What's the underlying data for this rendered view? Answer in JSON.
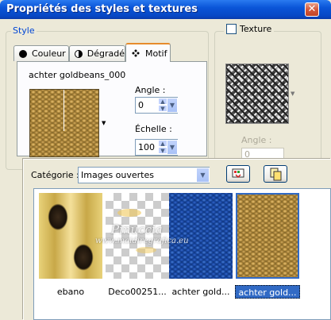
{
  "window": {
    "title": "Propriétés des styles et textures",
    "close_glyph": "✕"
  },
  "style_group": {
    "title": "Style",
    "tabs": [
      {
        "label": "Couleur",
        "icon": "filled-circle-icon"
      },
      {
        "label": "Dégradé",
        "icon": "half-circle-icon"
      },
      {
        "label": "Motif",
        "icon": "pattern-icon"
      }
    ],
    "pattern_name": "achter goldbeans_000",
    "angle_label": "Angle :",
    "angle_value": "0",
    "scale_label": "Échelle :",
    "scale_value": "100"
  },
  "texture_group": {
    "label": "Texture",
    "checked": false,
    "angle_label": "Angle :",
    "angle_value": "0"
  },
  "category": {
    "label": "Catégorie :",
    "selected": "Images ouvertes"
  },
  "thumbnails": [
    {
      "label": "ebano",
      "selected": false
    },
    {
      "label": "Deco00251...",
      "selected": false
    },
    {
      "label": "achter gold...",
      "selected": false
    },
    {
      "label": "achter gold...",
      "selected": true
    }
  ],
  "watermark": {
    "line1": "Pinuccia",
    "line2": "www.maidiregrafica.eu"
  },
  "colors": {
    "accent": "#316ac5",
    "title_bar": "#0a55d8",
    "gold": "#a88840",
    "blue_pattern": "#1a4aa8"
  }
}
